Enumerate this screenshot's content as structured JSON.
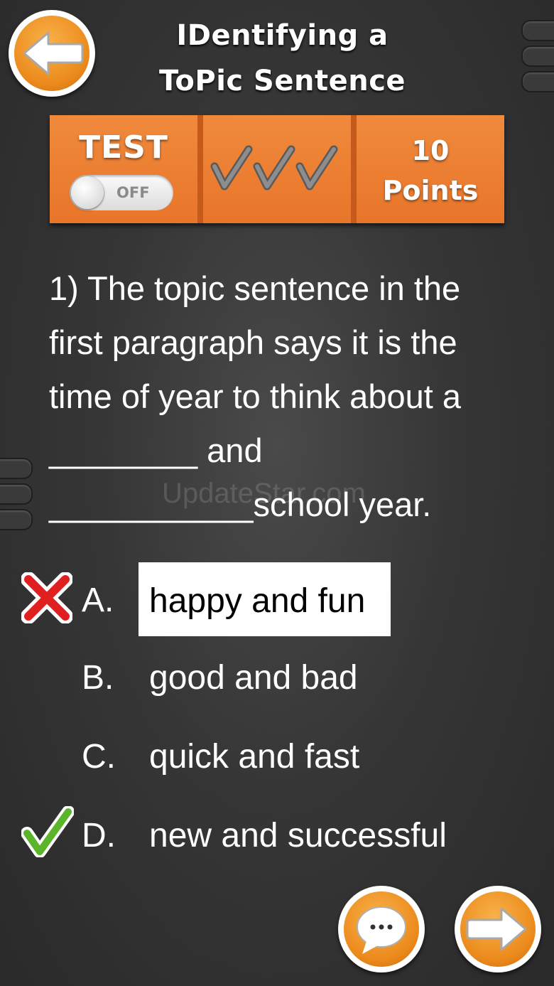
{
  "header": {
    "title_line1": "IDentifying a",
    "title_line2": "ToPic Sentence"
  },
  "status_bar": {
    "test_label": "TEST",
    "toggle_state": "OFF",
    "checks_count": 3,
    "points_value": "10",
    "points_label": "Points"
  },
  "question": {
    "line1": "1) The topic sentence in the",
    "line2": "first paragraph says it is the",
    "line3": "time of year to think about a",
    "line4": "________ and",
    "line5": "___________school year."
  },
  "answers": [
    {
      "letter": "A.",
      "text": "happy and fun",
      "selected": true,
      "mark": "wrong"
    },
    {
      "letter": "B.",
      "text": "good and bad",
      "selected": false,
      "mark": "none"
    },
    {
      "letter": "C.",
      "text": "quick and fast",
      "selected": false,
      "mark": "none"
    },
    {
      "letter": "D.",
      "text": "new and successful",
      "selected": false,
      "mark": "correct"
    }
  ],
  "watermark": "UpdateStar.com",
  "colors": {
    "accent_orange": "#ec8a1c",
    "panel_orange": "#e8752a",
    "wrong_red": "#e02020",
    "correct_green": "#5ab52a"
  },
  "icons": {
    "back": "arrow-left-icon",
    "next": "arrow-right-icon",
    "hint": "chat-bubble-icon",
    "wrong": "red-x-icon",
    "correct": "green-check-icon"
  }
}
